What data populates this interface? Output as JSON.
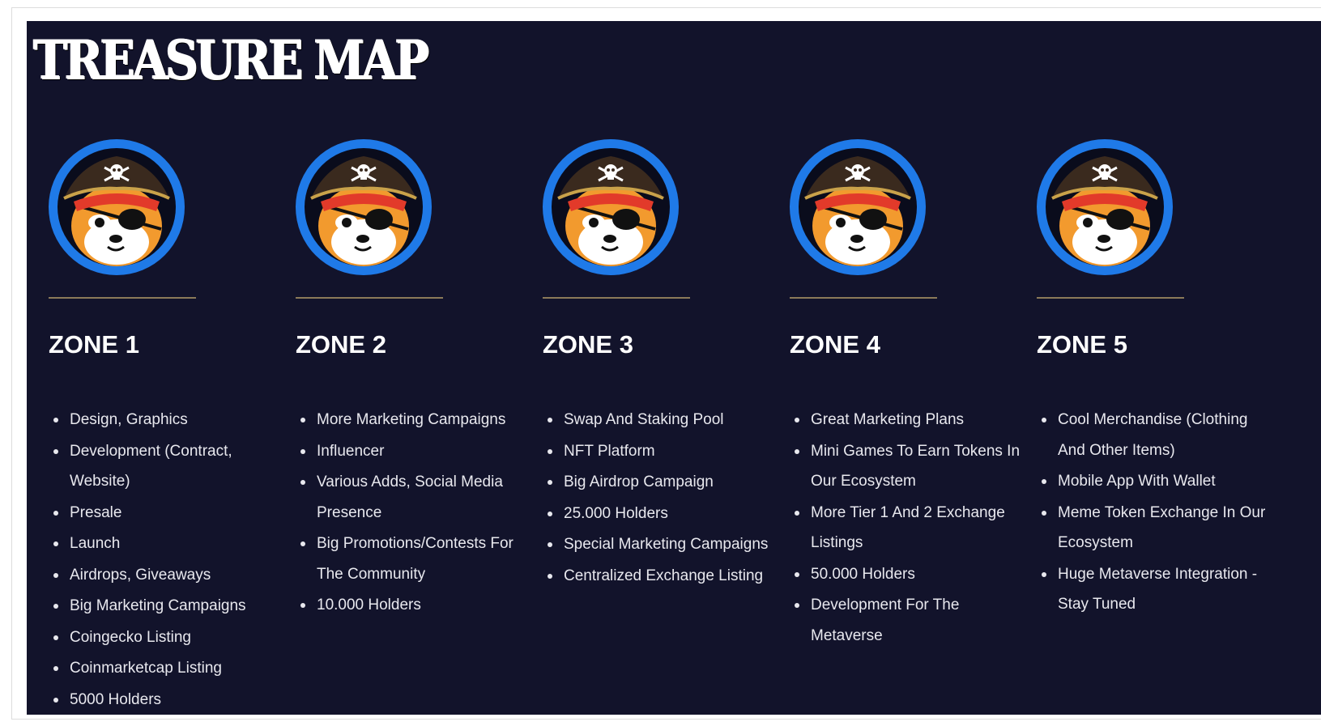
{
  "title": "TREASURE MAP",
  "colors": {
    "background": "#12132b",
    "avatar_ring": "#1f7ae8",
    "divider": "#8b7a59",
    "text": "#ffffff"
  },
  "zones": [
    {
      "name": "ZONE 1",
      "avatar_icon": "pirate-shiba-icon",
      "items": [
        "Design, Graphics",
        "Development (Contract, Website)",
        "Presale",
        "Launch",
        "Airdrops, Giveaways",
        "Big Marketing Campaigns",
        "Coingecko Listing",
        "Coinmarketcap Listing",
        "5000 Holders"
      ]
    },
    {
      "name": "ZONE 2",
      "avatar_icon": "pirate-shiba-icon",
      "items": [
        "More Marketing Campaigns",
        "Influencer",
        "Various Adds, Social Media Presence",
        "Big Promotions/Contests For The Community",
        "10.000 Holders"
      ]
    },
    {
      "name": "ZONE 3",
      "avatar_icon": "pirate-shiba-icon",
      "items": [
        "Swap And Staking Pool",
        "NFT Platform",
        "Big Airdrop Campaign",
        "25.000 Holders",
        "Special Marketing Campaigns",
        "Centralized Exchange Listing"
      ]
    },
    {
      "name": "ZONE 4",
      "avatar_icon": "pirate-shiba-icon",
      "items": [
        "Great Marketing Plans",
        "Mini Games To Earn Tokens In Our Ecosystem",
        "More Tier 1 And 2 Exchange Listings",
        "50.000 Holders",
        "Development For The Metaverse"
      ]
    },
    {
      "name": "ZONE 5",
      "avatar_icon": "pirate-shiba-icon",
      "items": [
        "Cool Merchandise (Clothing And Other Items)",
        "Mobile App With Wallet",
        "Meme Token Exchange In Our Ecosystem",
        "Huge Metaverse Integration - Stay Tuned"
      ]
    }
  ]
}
